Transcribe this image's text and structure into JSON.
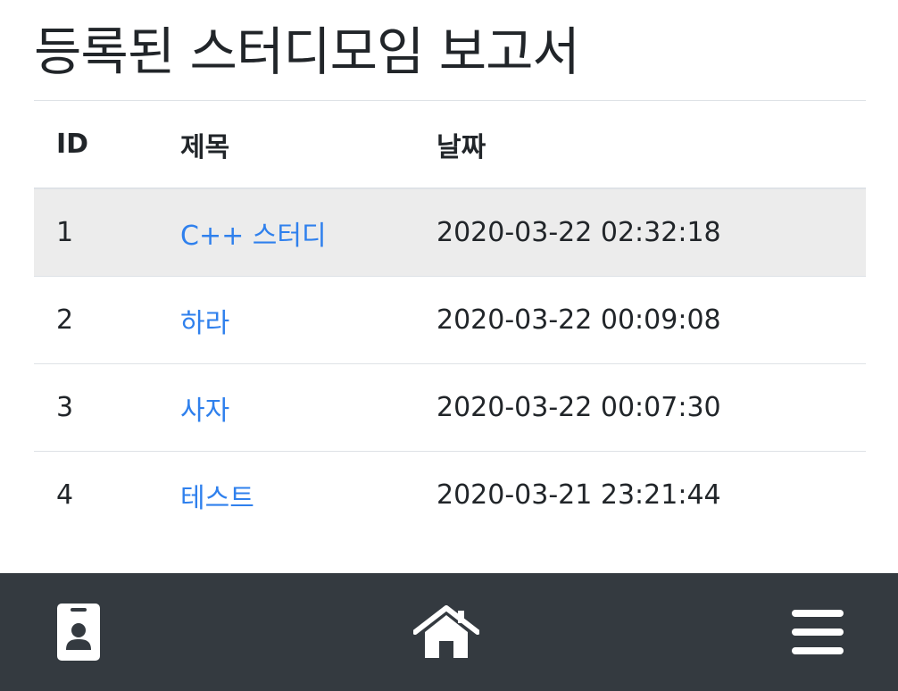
{
  "page": {
    "title": "등록된 스터디모임 보고서"
  },
  "table": {
    "headers": {
      "id": "ID",
      "title": "제목",
      "date": "날짜"
    },
    "rows": [
      {
        "id": "1",
        "title": "C++ 스터디",
        "date": "2020-03-22 02:32:18",
        "highlighted": true
      },
      {
        "id": "2",
        "title": "하라",
        "date": "2020-03-22 00:09:08"
      },
      {
        "id": "3",
        "title": "사자",
        "date": "2020-03-22 00:07:30"
      },
      {
        "id": "4",
        "title": "테스트",
        "date": "2020-03-21 23:21:44"
      }
    ]
  },
  "bottom_nav": {
    "items": [
      {
        "icon": "id-badge-icon"
      },
      {
        "icon": "home-icon"
      },
      {
        "icon": "hamburger-menu-icon"
      }
    ]
  },
  "colors": {
    "link": "#2f80ed",
    "nav_background": "#343a40",
    "highlight_row": "#ececec"
  }
}
